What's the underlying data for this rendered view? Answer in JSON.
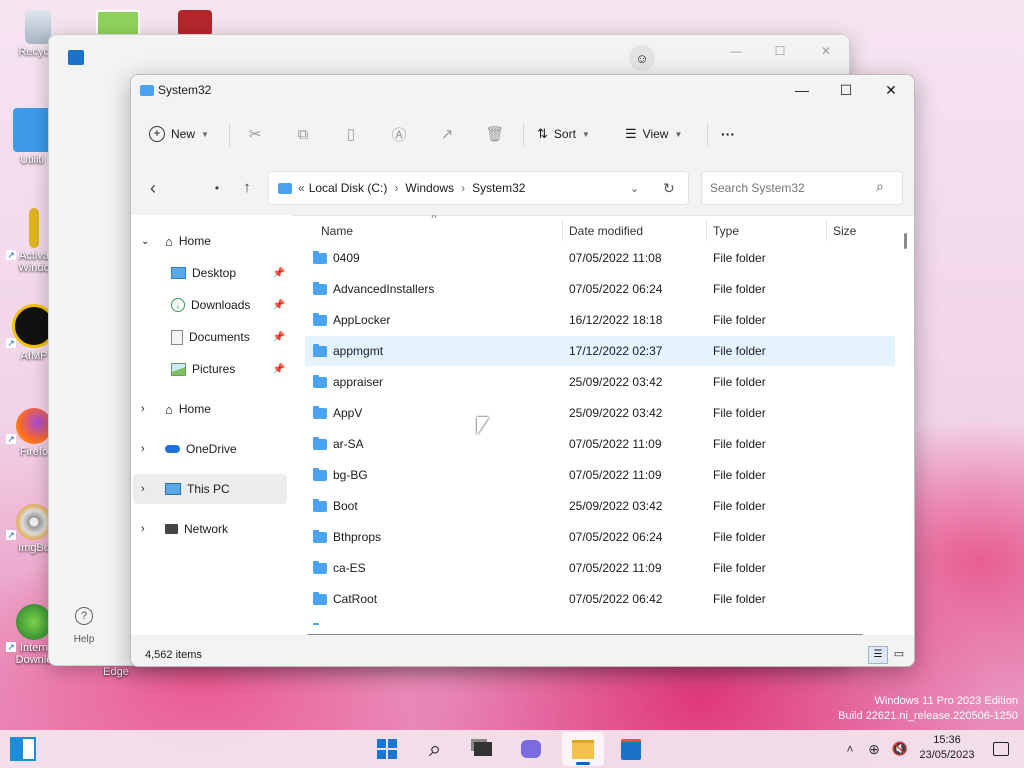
{
  "desktop": {
    "icons": [
      {
        "label": "Recycle"
      },
      {
        "label": "Utiliti"
      },
      {
        "label": "Activa Windo"
      },
      {
        "label": "AIMP"
      },
      {
        "label": "Firefo"
      },
      {
        "label": "ImgBu"
      },
      {
        "label": "Intern Downlo"
      },
      {
        "label": "Edge"
      }
    ]
  },
  "back_window": {
    "help_label": "Help"
  },
  "explorer": {
    "title": "System32",
    "toolbar": {
      "new_label": "New",
      "sort_label": "Sort",
      "view_label": "View",
      "more_label": "···"
    },
    "address": {
      "prefix": "«",
      "crumbs": [
        "Local Disk (C:)",
        "Windows",
        "System32"
      ],
      "search_placeholder": "Search System32"
    },
    "nav": {
      "home": "Home",
      "quick": [
        {
          "label": "Desktop"
        },
        {
          "label": "Downloads"
        },
        {
          "label": "Documents"
        },
        {
          "label": "Pictures"
        }
      ],
      "home2": "Home",
      "onedrive": "OneDrive",
      "thispc": "This PC",
      "network": "Network"
    },
    "columns": {
      "name": "Name",
      "date": "Date modified",
      "type": "Type",
      "size": "Size"
    },
    "rows": [
      {
        "name": "0409",
        "date": "07/05/2022 11:08",
        "type": "File folder"
      },
      {
        "name": "AdvancedInstallers",
        "date": "07/05/2022 06:24",
        "type": "File folder"
      },
      {
        "name": "AppLocker",
        "date": "16/12/2022 18:18",
        "type": "File folder"
      },
      {
        "name": "appmgmt",
        "date": "17/12/2022 02:37",
        "type": "File folder"
      },
      {
        "name": "appraiser",
        "date": "25/09/2022 03:42",
        "type": "File folder"
      },
      {
        "name": "AppV",
        "date": "25/09/2022 03:42",
        "type": "File folder"
      },
      {
        "name": "ar-SA",
        "date": "07/05/2022 11:09",
        "type": "File folder"
      },
      {
        "name": "bg-BG",
        "date": "07/05/2022 11:09",
        "type": "File folder"
      },
      {
        "name": "Boot",
        "date": "25/09/2022 03:42",
        "type": "File folder"
      },
      {
        "name": "Bthprops",
        "date": "07/05/2022 06:24",
        "type": "File folder"
      },
      {
        "name": "ca-ES",
        "date": "07/05/2022 11:09",
        "type": "File folder"
      },
      {
        "name": "CatRoot",
        "date": "07/05/2022 06:42",
        "type": "File folder"
      }
    ],
    "status": "4,562 items"
  },
  "watermark": {
    "line1": "Windows 11 Pro 2023 Edition",
    "line2": "Build 22621.ni_release.220506-1250"
  },
  "taskbar": {
    "time": "15:36",
    "date": "23/05/2023"
  },
  "colors": {
    "accent": "#0067c0",
    "folder": "#4aa3f0",
    "selected_row": "#e5f3ff"
  }
}
